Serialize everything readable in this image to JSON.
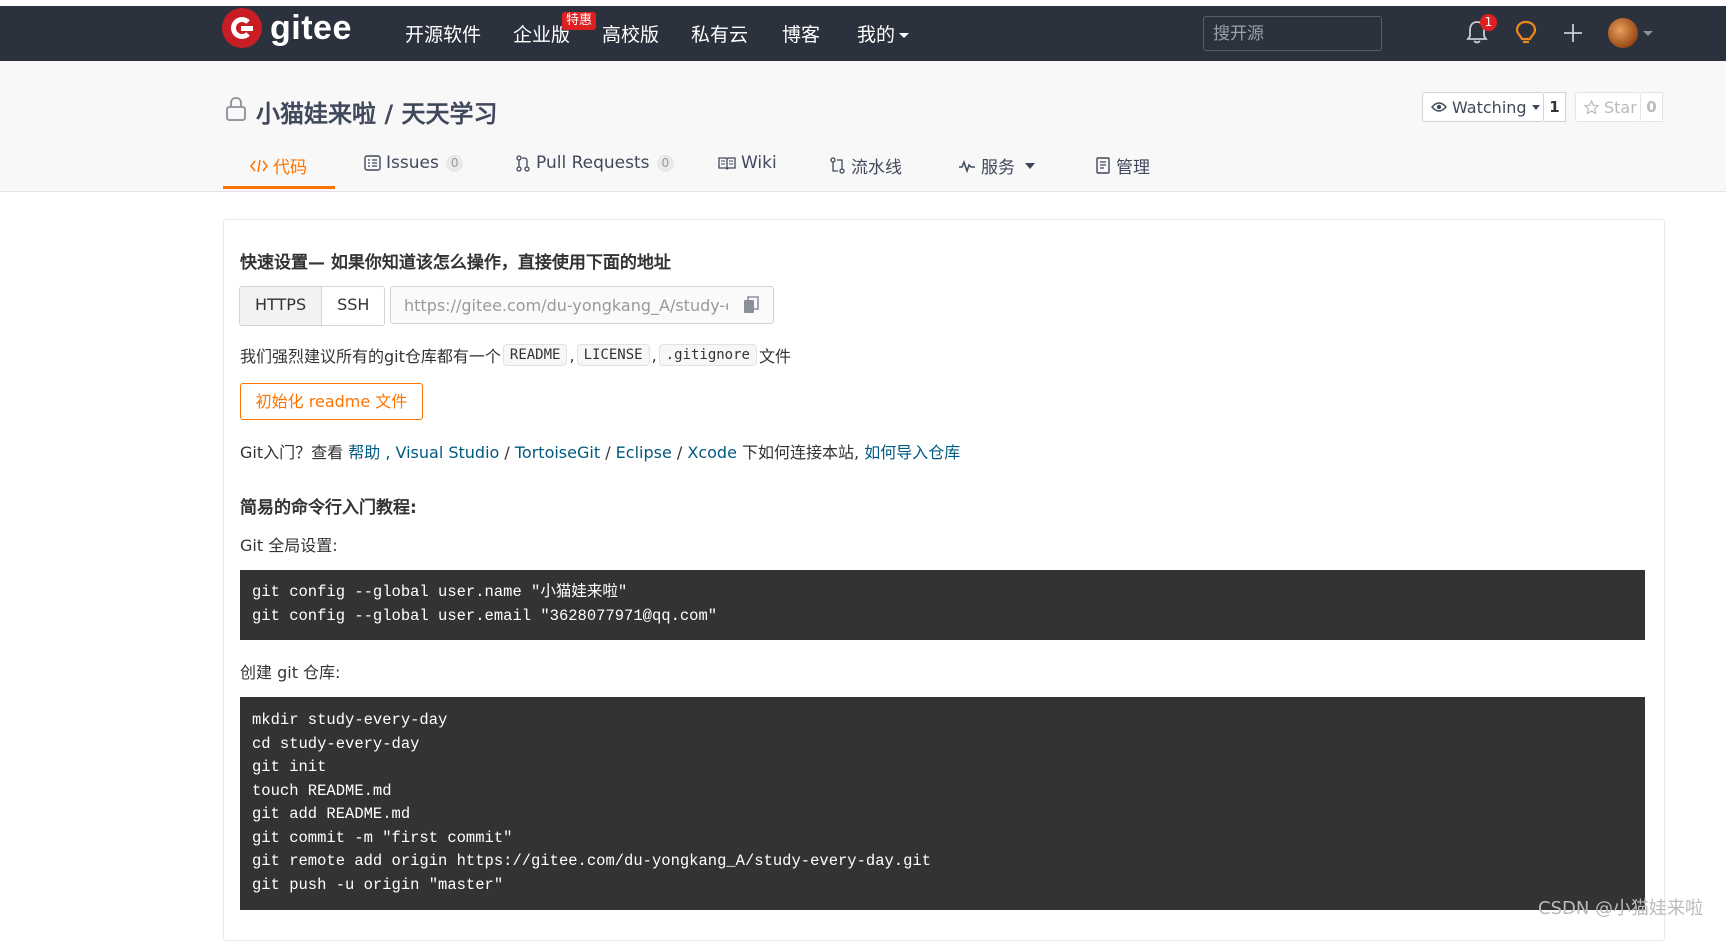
{
  "navbar": {
    "logo_text": "gitee",
    "links": [
      "开源软件",
      "企业版",
      "高校版",
      "私有云",
      "博客",
      "我的"
    ],
    "hot_badge": "特惠",
    "search_placeholder": "搜开源",
    "notification_count": "1",
    "icons": [
      "bell-icon",
      "lightbulb-icon",
      "plus-icon",
      "avatar"
    ]
  },
  "repo": {
    "title": "小猫娃来啦 / 天天学习",
    "watch_label": "Watching",
    "watch_count": "1",
    "star_label": "Star",
    "star_count": "0"
  },
  "tabs": [
    {
      "label": "代码",
      "icon": "code-icon",
      "active": true
    },
    {
      "label": "Issues",
      "icon": "issues-icon",
      "count": "0"
    },
    {
      "label": "Pull Requests",
      "icon": "pull-request-icon",
      "count": "0"
    },
    {
      "label": "Wiki",
      "icon": "wiki-icon"
    },
    {
      "label": "流水线",
      "icon": "pipeline-icon"
    },
    {
      "label": "服务",
      "icon": "service-icon"
    },
    {
      "label": "管理",
      "icon": "manage-icon"
    }
  ],
  "quick_setup": {
    "title": "快速设置— 如果你知道该怎么操作，直接使用下面的地址",
    "protocols": [
      "HTTPS",
      "SSH"
    ],
    "url": "https://gitee.com/du-yongkang_A/study-ev",
    "recommend_prefix": "我们强烈建议所有的git仓库都有一个",
    "recommend_files": [
      "README",
      "LICENSE",
      ".gitignore"
    ],
    "recommend_sep": ",",
    "recommend_suffix": "文件",
    "init_button": "初始化 readme 文件",
    "git_intro_prefix": "Git入门？查看",
    "help_link": "帮助",
    "links": [
      "Visual Studio",
      "TortoiseGit",
      "Eclipse",
      "Xcode"
    ],
    "git_intro_middle": "下如何连接本站,",
    "import_link": "如何导入仓库"
  },
  "tutorial": {
    "title": "简易的命令行入门教程:",
    "global_label": "Git 全局设置:",
    "global_code": [
      "git config --global user.name \"小猫娃来啦\"",
      "git config --global user.email \"3628077971@qq.com\""
    ],
    "create_label": "创建 git 仓库:",
    "create_code": [
      "mkdir study-every-day",
      "cd study-every-day",
      "git init",
      "touch README.md",
      "git add README.md",
      "git commit -m \"first commit\"",
      "git remote add origin https://gitee.com/du-yongkang_A/study-every-day.git",
      "git push -u origin \"master\""
    ]
  },
  "watermark": "CSDN @小猫娃来啦",
  "colors": {
    "topbar": "#2b323e",
    "accent": "#fe7300",
    "brand_red": "#c71d23",
    "link": "#005980",
    "code_bg": "#333333"
  }
}
